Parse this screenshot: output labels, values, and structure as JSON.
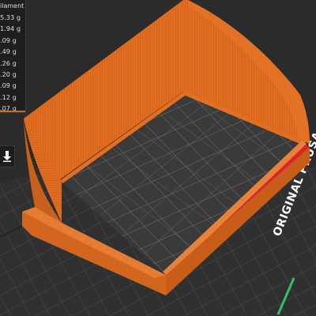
{
  "filament_panel": {
    "header": "ilament",
    "rows": [
      "5.33 g",
      "1.94 g",
      ".09 g",
      ".49 g",
      ".26 g",
      ".20 g",
      ".09 g",
      ".12 g",
      ".07 g"
    ]
  },
  "bed_label": "ORIGINAL PRUSA",
  "icons": {
    "download": "download-arrow-icon"
  },
  "colors": {
    "model_orange": "#e26f22",
    "selection_red": "#d8262a",
    "bed_dark": "#2e2e2e",
    "grid_line": "#5a5a5a",
    "highlight_green": "#2fbf6a"
  }
}
